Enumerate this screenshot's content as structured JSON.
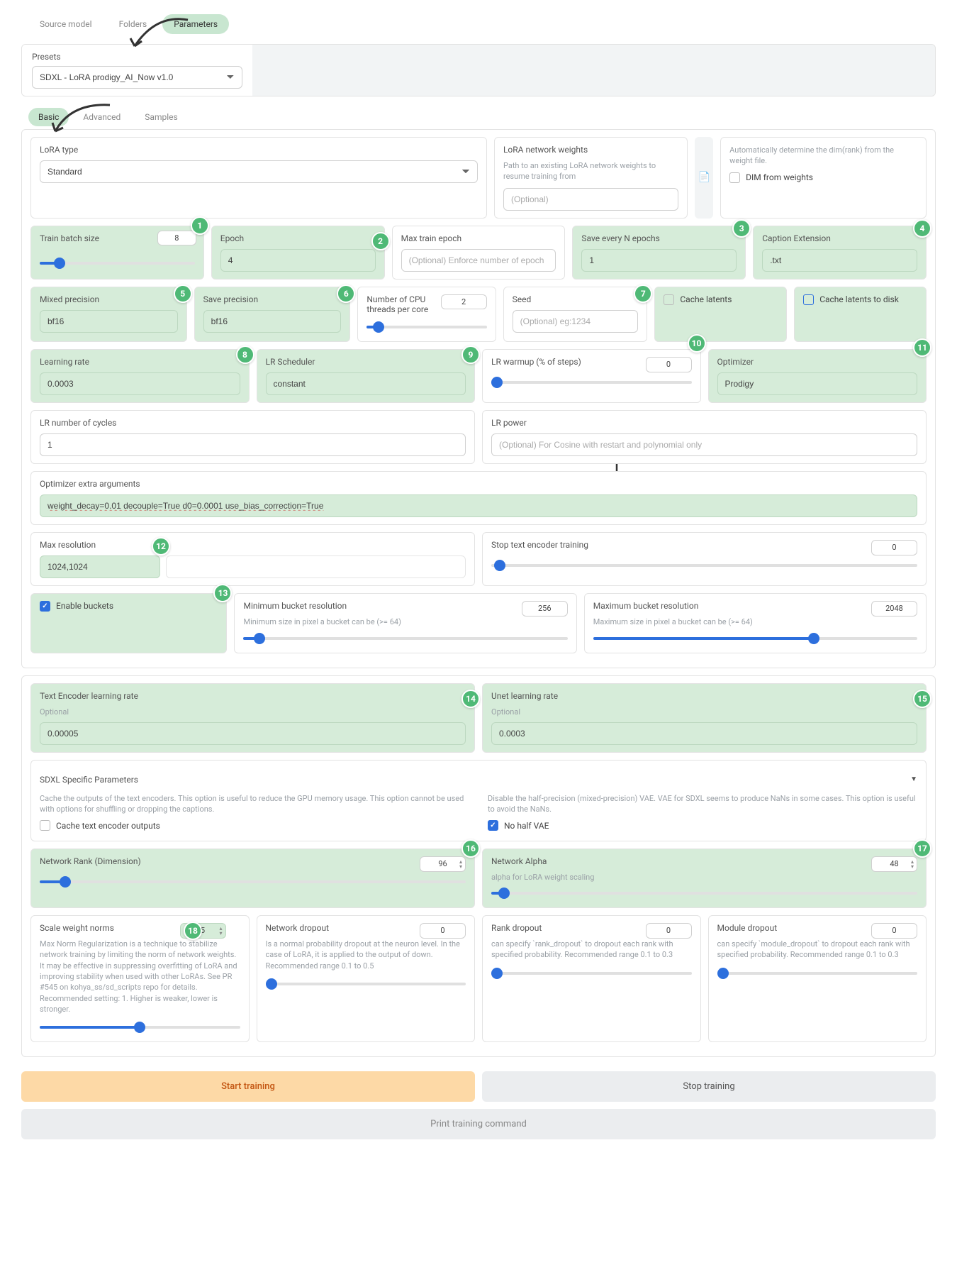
{
  "topTabs": {
    "source": "Source model",
    "folders": "Folders",
    "parameters": "Parameters"
  },
  "presets": {
    "label": "Presets",
    "value": "SDXL - LoRA prodigy_AI_Now v1.0"
  },
  "subTabs": {
    "basic": "Basic",
    "advanced": "Advanced",
    "samples": "Samples"
  },
  "lora": {
    "typeLabel": "LoRA type",
    "typeValue": "Standard",
    "weightsLabel": "LoRA network weights",
    "weightsHint": "Path to an existing LoRA network weights to resume training from",
    "weightsPlaceholder": "(Optional)",
    "dimHint": "Automatically determine the dim(rank) from the weight file.",
    "dimLabel": "DIM from weights"
  },
  "p": {
    "trainBatchLabel": "Train batch size",
    "trainBatchValue": "8",
    "epochLabel": "Epoch",
    "epochValue": "4",
    "maxTrainEpochLabel": "Max train epoch",
    "maxTrainEpochPlaceholder": "(Optional) Enforce number of epoch",
    "saveEveryLabel": "Save every N epochs",
    "saveEveryValue": "1",
    "captionExtLabel": "Caption Extension",
    "captionExtValue": ".txt",
    "mixedPrecLabel": "Mixed precision",
    "mixedPrecValue": "bf16",
    "savePrecLabel": "Save precision",
    "savePrecValue": "bf16",
    "cpuThreadsLabel": "Number of CPU threads per core",
    "cpuThreadsValue": "2",
    "seedLabel": "Seed",
    "seedPlaceholder": "(Optional) eg:1234",
    "cacheLatentsLabel": "Cache latents",
    "cacheLatentsDiskLabel": "Cache latents to disk",
    "lrLabel": "Learning rate",
    "lrValue": "0.0003",
    "lrSchedLabel": "LR Scheduler",
    "lrSchedValue": "constant",
    "lrWarmupLabel": "LR warmup (% of steps)",
    "lrWarmupValue": "0",
    "optimizerLabel": "Optimizer",
    "optimizerValue": "Prodigy",
    "lrCyclesLabel": "LR number of cycles",
    "lrCyclesValue": "1",
    "lrPowerLabel": "LR power",
    "lrPowerPlaceholder": "(Optional) For Cosine with restart and polynomial only",
    "optExtraLabel": "Optimizer extra arguments",
    "optExtraValue": "weight_decay=0.01 decouple=True d0=0.0001 use_bias_correction=True",
    "maxResLabel": "Max resolution",
    "maxResValue": "1024,1024",
    "stopTELabel": "Stop text encoder training",
    "stopTEValue": "0",
    "enableBucketsLabel": "Enable buckets",
    "minBucketLabel": "Minimum bucket resolution",
    "minBucketHint": "Minimum size in pixel a bucket can be (>= 64)",
    "minBucketValue": "256",
    "maxBucketLabel": "Maximum bucket resolution",
    "maxBucketHint": "Maximum size in pixel a bucket can be (>= 64)",
    "maxBucketValue": "2048",
    "teLrLabel": "Text Encoder learning rate",
    "teLrHint": "Optional",
    "teLrValue": "0.00005",
    "unetLrLabel": "Unet learning rate",
    "unetLrHint": "Optional",
    "unetLrValue": "0.0003"
  },
  "sdxl": {
    "header": "SDXL Specific Parameters",
    "cacheTEHint": "Cache the outputs of the text encoders. This option is useful to reduce the GPU memory usage. This option cannot be used with options for shuffling or dropping the captions.",
    "cacheTELabel": "Cache text encoder outputs",
    "noHalfHint": "Disable the half-precision (mixed-precision) VAE. VAE for SDXL seems to produce NaNs in some cases. This option is useful to avoid the NaNs.",
    "noHalfLabel": "No half VAE"
  },
  "net": {
    "rankLabel": "Network Rank (Dimension)",
    "rankValue": "96",
    "alphaLabel": "Network Alpha",
    "alphaHint": "alpha for LoRA weight scaling",
    "alphaValue": "48",
    "scaleLabel": "Scale weight norms",
    "scaleHint": "Max Norm Regularization is a technique to stabilize network training by limiting the norm of network weights. It may be effective in suppressing overfitting of LoRA and improving stability when used with other LoRAs. See PR #545 on kohya_ss/sd_scripts repo for details. Recommended setting: 1. Higher is weaker, lower is stronger.",
    "scaleValue": "5",
    "netDropLabel": "Network dropout",
    "netDropHint": "Is a normal probability dropout at the neuron level. In the case of LoRA, it is applied to the output of down. Recommended range 0.1 to 0.5",
    "netDropValue": "0",
    "rankDropLabel": "Rank dropout",
    "rankDropHint": "can specify `rank_dropout` to dropout each rank with specified probability. Recommended range 0.1 to 0.3",
    "rankDropValue": "0",
    "modDropLabel": "Module dropout",
    "modDropHint": "can specify `module_dropout` to dropout each rank with specified probability. Recommended range 0.1 to 0.3",
    "modDropValue": "0"
  },
  "actions": {
    "start": "Start training",
    "stop": "Stop training",
    "print": "Print training command"
  }
}
